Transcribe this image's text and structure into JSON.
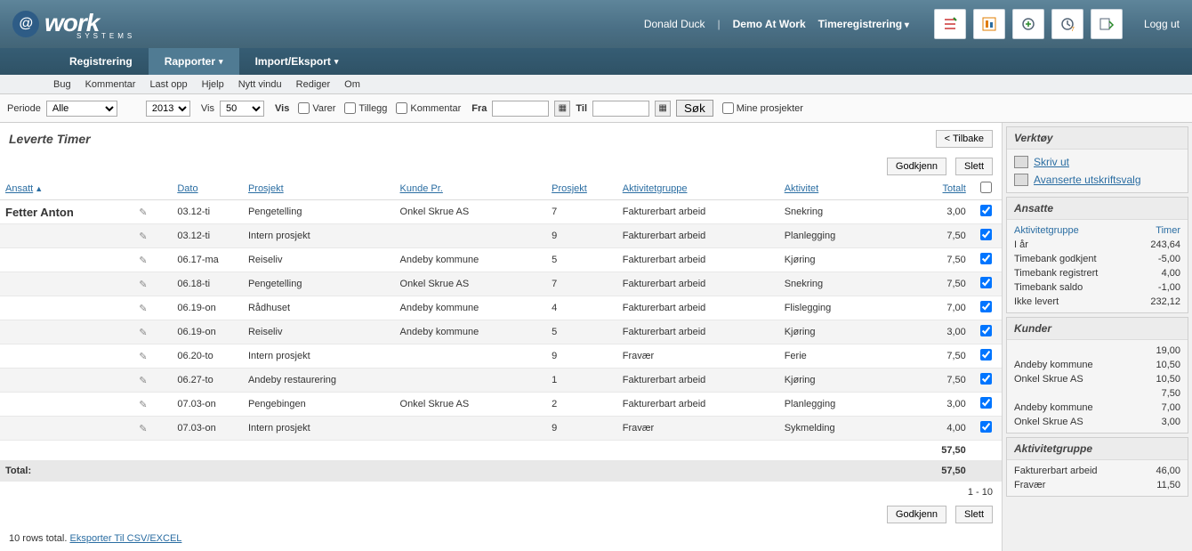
{
  "header": {
    "user": "Donald Duck",
    "company": "Demo At Work",
    "module": "Timeregistrering",
    "logout": "Logg ut"
  },
  "logo": {
    "main": "work",
    "sub": "SYSTEMS"
  },
  "nav": {
    "items": [
      {
        "label": "Registrering",
        "active": false,
        "dd": false
      },
      {
        "label": "Rapporter",
        "active": true,
        "dd": true
      },
      {
        "label": "Import/Eksport",
        "active": false,
        "dd": true
      }
    ]
  },
  "menubar": [
    "Bug",
    "Kommentar",
    "Last opp",
    "Hjelp",
    "Nytt vindu",
    "Rediger",
    "Om"
  ],
  "toolbar": {
    "period_label": "Periode",
    "period_value": "Alle",
    "year_value": "2013",
    "vis_label": "Vis",
    "count_value": "50",
    "vis2_label": "Vis",
    "chk_varer": "Varer",
    "chk_tillegg": "Tillegg",
    "chk_kommentar": "Kommentar",
    "fra": "Fra",
    "til": "Til",
    "sok": "Søk",
    "mine": "Mine prosjekter"
  },
  "panel": {
    "title": "Leverte Timer",
    "back": "< Tilbake",
    "approve": "Godkjenn",
    "delete": "Slett"
  },
  "columns": {
    "ansatt": "Ansatt",
    "dato": "Dato",
    "prosjekt": "Prosjekt",
    "kunde": "Kunde Pr.",
    "prosjekt2": "Prosjekt",
    "aktgruppe": "Aktivitetgruppe",
    "aktivitet": "Aktivitet",
    "totalt": "Totalt"
  },
  "employee": "Fetter Anton",
  "rows": [
    {
      "dato": "03.12-ti",
      "prosjekt": "Pengetelling",
      "kunde": "Onkel Skrue AS",
      "pr": "7",
      "grp": "Fakturerbart arbeid",
      "akt": "Snekring",
      "tot": "3,00"
    },
    {
      "dato": "03.12-ti",
      "prosjekt": "Intern prosjekt",
      "kunde": "",
      "pr": "9",
      "grp": "Fakturerbart arbeid",
      "akt": "Planlegging",
      "tot": "7,50"
    },
    {
      "dato": "06.17-ma",
      "prosjekt": "Reiseliv",
      "kunde": "Andeby kommune",
      "pr": "5",
      "grp": "Fakturerbart arbeid",
      "akt": "Kjøring",
      "tot": "7,50"
    },
    {
      "dato": "06.18-ti",
      "prosjekt": "Pengetelling",
      "kunde": "Onkel Skrue AS",
      "pr": "7",
      "grp": "Fakturerbart arbeid",
      "akt": "Snekring",
      "tot": "7,50"
    },
    {
      "dato": "06.19-on",
      "prosjekt": "Rådhuset",
      "kunde": "Andeby kommune",
      "pr": "4",
      "grp": "Fakturerbart arbeid",
      "akt": "Flislegging",
      "tot": "7,00"
    },
    {
      "dato": "06.19-on",
      "prosjekt": "Reiseliv",
      "kunde": "Andeby kommune",
      "pr": "5",
      "grp": "Fakturerbart arbeid",
      "akt": "Kjøring",
      "tot": "3,00"
    },
    {
      "dato": "06.20-to",
      "prosjekt": "Intern prosjekt",
      "kunde": "",
      "pr": "9",
      "grp": "Fravær",
      "akt": "Ferie",
      "tot": "7,50"
    },
    {
      "dato": "06.27-to",
      "prosjekt": "Andeby restaurering",
      "kunde": "",
      "pr": "1",
      "grp": "Fakturerbart arbeid",
      "akt": "Kjøring",
      "tot": "7,50"
    },
    {
      "dato": "07.03-on",
      "prosjekt": "Pengebingen",
      "kunde": "Onkel Skrue AS",
      "pr": "2",
      "grp": "Fakturerbart arbeid",
      "akt": "Planlegging",
      "tot": "3,00"
    },
    {
      "dato": "07.03-on",
      "prosjekt": "Intern prosjekt",
      "kunde": "",
      "pr": "9",
      "grp": "Fravær",
      "akt": "Sykmelding",
      "tot": "4,00"
    }
  ],
  "subtotal": "57,50",
  "grand_label": "Total:",
  "grand_total": "57,50",
  "pagination": "1 - 10",
  "footer_rows": "10 rows total.",
  "footer_export": "Eksporter Til CSV/EXCEL",
  "side": {
    "verktoy": {
      "title": "Verktøy",
      "print": "Skriv ut",
      "adv": "Avanserte utskriftsvalg"
    },
    "ansatte": {
      "title": "Ansatte",
      "col1": "Aktivitetgruppe",
      "col2": "Timer",
      "rows": [
        {
          "k": "I år",
          "v": "243,64"
        },
        {
          "k": "Timebank godkjent",
          "v": "-5,00"
        },
        {
          "k": "Timebank registrert",
          "v": "4,00"
        },
        {
          "k": "Timebank saldo",
          "v": "-1,00"
        },
        {
          "k": "Ikke levert",
          "v": "232,12"
        }
      ]
    },
    "kunder": {
      "title": "Kunder",
      "rows": [
        {
          "k": "",
          "v": "19,00"
        },
        {
          "k": "Andeby kommune",
          "v": "10,50"
        },
        {
          "k": "Onkel Skrue AS",
          "v": "10,50"
        },
        {
          "k": "",
          "v": "7,50"
        },
        {
          "k": "Andeby kommune",
          "v": "7,00"
        },
        {
          "k": "Onkel Skrue AS",
          "v": "3,00"
        }
      ]
    },
    "aktgrp": {
      "title": "Aktivitetgruppe",
      "rows": [
        {
          "k": "Fakturerbart arbeid",
          "v": "46,00"
        },
        {
          "k": "Fravær",
          "v": "11,50"
        }
      ]
    }
  }
}
